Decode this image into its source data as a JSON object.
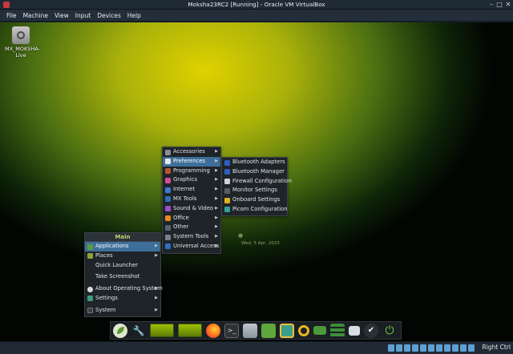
{
  "window": {
    "title": "Moksha23RC2 [Running] - Oracle VM VirtualBox",
    "controls": [
      "minimize-icon",
      "maximize-icon",
      "close-icon"
    ]
  },
  "menubar": [
    "File",
    "Machine",
    "View",
    "Input",
    "Devices",
    "Help"
  ],
  "desktop": {
    "icon_label": "MX_MOKSHA-Live",
    "faint_date": "Wed, 5 Apr, 2023"
  },
  "main_menu": {
    "header": "Main",
    "items": [
      {
        "label": "Applications",
        "icon": "apps-icon",
        "submenu": true,
        "selected": true
      },
      {
        "label": "Places",
        "icon": "folder-icon",
        "submenu": true
      },
      {
        "label": "Quick Launcher",
        "icon": "",
        "submenu": false
      },
      {
        "label": "Take Screenshot",
        "icon": "",
        "submenu": false
      },
      {
        "label": "About Operating System",
        "icon": "info-icon",
        "submenu": true
      },
      {
        "label": "Settings",
        "icon": "settings-icon",
        "submenu": true
      },
      {
        "label": "System",
        "icon": "system-icon",
        "submenu": true
      }
    ]
  },
  "apps_menu": {
    "items": [
      {
        "label": "Accessories",
        "icon": "accessories-icon",
        "color": "#8a8f95"
      },
      {
        "label": "Preferences",
        "icon": "preferences-icon",
        "color": "#e8e8e8",
        "selected": true
      },
      {
        "label": "Programming",
        "icon": "programming-icon",
        "color": "#b5572e"
      },
      {
        "label": "Graphics",
        "icon": "graphics-icon",
        "color": "#d54d8f"
      },
      {
        "label": "Internet",
        "icon": "internet-icon",
        "color": "#3c7bd1"
      },
      {
        "label": "MX Tools",
        "icon": "mx-tools-icon",
        "color": "#2f6db8"
      },
      {
        "label": "Sound & Video",
        "icon": "sound-video-icon",
        "color": "#9b4fc6"
      },
      {
        "label": "Office",
        "icon": "office-icon",
        "color": "#e48a1d"
      },
      {
        "label": "Other",
        "icon": "other-icon",
        "color": "#566270"
      },
      {
        "label": "System Tools",
        "icon": "system-tools-icon",
        "color": "#7b8188"
      },
      {
        "label": "Universal Access",
        "icon": "universal-access-icon",
        "color": "#2e6fc8"
      }
    ]
  },
  "prefs_menu": {
    "items": [
      {
        "label": "Bluetooth Adapters",
        "icon": "bluetooth-icon",
        "color": "#2f5fc0"
      },
      {
        "label": "Bluetooth Manager",
        "icon": "bluetooth-icon",
        "color": "#2f5fc0"
      },
      {
        "label": "Firewall Configuration",
        "icon": "firewall-icon",
        "color": "#d0d4d8"
      },
      {
        "label": "Monitor Settings",
        "icon": "monitor-icon",
        "color": "#5a5f64"
      },
      {
        "label": "Onboard Settings",
        "icon": "onboard-icon",
        "color": "#e0b020"
      },
      {
        "label": "Picom Configuration",
        "icon": "picom-icon",
        "color": "#30a09a"
      }
    ]
  },
  "dock": [
    "leaf-icon",
    "wrench-icon",
    "workspace-1",
    "workspace-2",
    "firefox-icon",
    "terminal-icon",
    "files-icon",
    "archive-icon",
    "screenshot-icon",
    "media-icon",
    "battery-icon",
    "list-icon",
    "network-icon",
    "check-icon",
    "power-icon"
  ],
  "statusbar": {
    "host_key": "Right Ctrl"
  }
}
